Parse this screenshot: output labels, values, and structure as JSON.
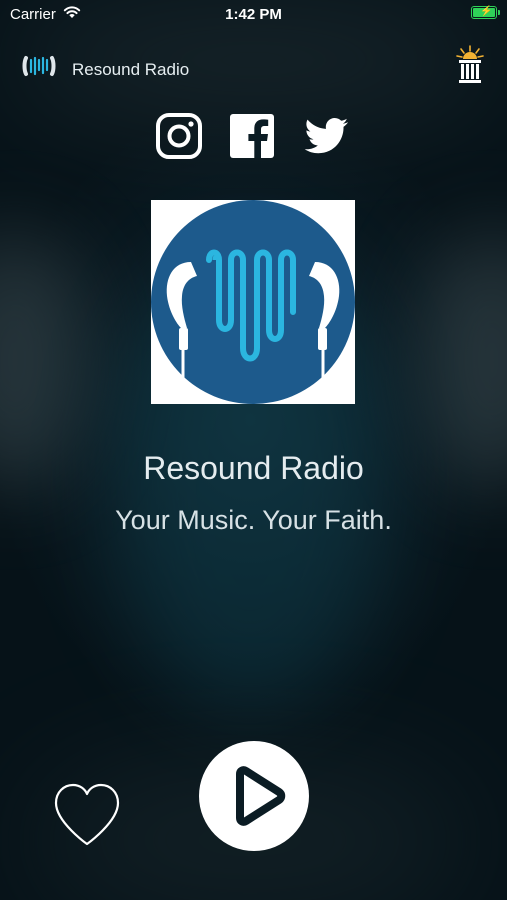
{
  "status_bar": {
    "carrier": "Carrier",
    "time": "1:42 PM"
  },
  "header": {
    "title": "Resound Radio"
  },
  "now_playing": {
    "station": "Resound Radio",
    "tagline": "Your Music. Your Faith."
  },
  "icons": [
    "radio-logo-icon",
    "partner-logo-icon",
    "instagram-icon",
    "facebook-icon",
    "twitter-icon",
    "heart-icon",
    "play-icon"
  ],
  "colors": {
    "brand_blue": "#1d5a8c",
    "accent_cyan": "#2bb6e0",
    "battery": "#2fd158"
  }
}
